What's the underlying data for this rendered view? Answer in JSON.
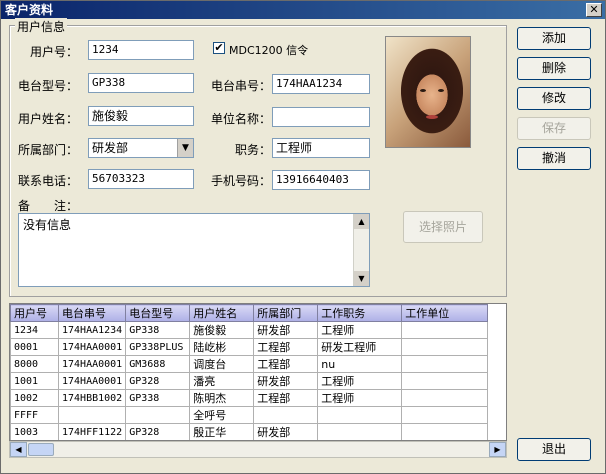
{
  "window": {
    "title": "客户资料",
    "close_glyph": "✕"
  },
  "group": {
    "title": "用户信息"
  },
  "labels": {
    "user_id": "用户号：",
    "device_model": "电台型号：",
    "user_name": "用户姓名：",
    "department": "所属部门：",
    "phone": "联系电话：",
    "device_serial": "电台串号：",
    "company": "单位名称：",
    "position": "职务：",
    "mobile": "手机号码：",
    "remark": "备　　注："
  },
  "fields": {
    "user_id": "1234",
    "device_model": "GP338",
    "user_name": "施俊毅",
    "department": "研发部",
    "phone": "56703323",
    "device_serial": "174HAA1234",
    "company": "",
    "position": "工程师",
    "mobile": "13916640403",
    "remark": "没有信息"
  },
  "checkbox": {
    "label": "MDC1200 信令",
    "checked": true,
    "mark": "✔"
  },
  "buttons": {
    "add": "添加",
    "delete": "删除",
    "edit": "修改",
    "save": "保存",
    "cancel": "撤消",
    "choose_photo": "选择照片",
    "exit": "退出"
  },
  "grid": {
    "columns": [
      "用户号",
      "电台串号",
      "电台型号",
      "用户姓名",
      "所属部门",
      "工作职务",
      "工作单位"
    ],
    "rows": [
      [
        "1234",
        "174HAA1234",
        "GP338",
        "施俊毅",
        "研发部",
        "工程师",
        ""
      ],
      [
        "0001",
        "174HAA0001",
        "GP338PLUS",
        "陆屹彬",
        "工程部",
        "研发工程师",
        ""
      ],
      [
        "8000",
        "174HAA0001",
        "GM3688",
        "调度台",
        "工程部",
        "nu",
        ""
      ],
      [
        "1001",
        "174HAA0001",
        "GP328",
        "潘亮",
        "研发部",
        "工程师",
        ""
      ],
      [
        "1002",
        "174HBB1002",
        "GP338",
        "陈明杰",
        "工程部",
        "工程师",
        ""
      ],
      [
        "FFFF",
        "",
        "",
        "全呼号",
        "",
        "",
        ""
      ],
      [
        "1003",
        "174HFF1122",
        "GP328",
        "殷正华",
        "研发部",
        "",
        ""
      ]
    ]
  },
  "icons": {
    "dropdown_arrow": "▼",
    "scroll_up": "▲",
    "scroll_down": "▼",
    "scroll_left": "◀",
    "scroll_right": "▶"
  }
}
